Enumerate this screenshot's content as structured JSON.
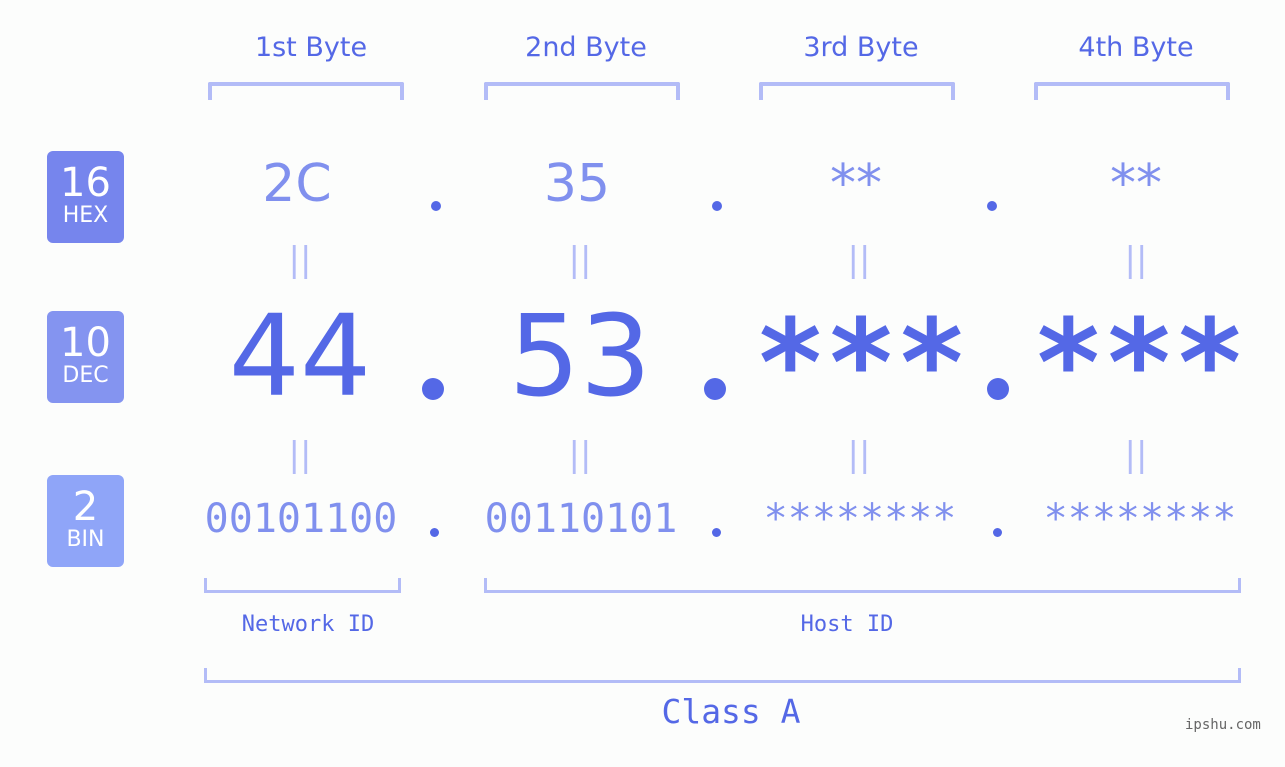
{
  "bytes": [
    {
      "label": "1st Byte",
      "hex": "2C",
      "dec": "44",
      "bin": "00101100"
    },
    {
      "label": "2nd Byte",
      "hex": "35",
      "dec": "53",
      "bin": "00110101"
    },
    {
      "label": "3rd Byte",
      "hex": "**",
      "dec": "***",
      "bin": "********"
    },
    {
      "label": "4th Byte",
      "hex": "**",
      "dec": "***",
      "bin": "********"
    }
  ],
  "rows": {
    "hex": {
      "num": "16",
      "label": "HEX",
      "color": "#7685ed"
    },
    "dec": {
      "num": "10",
      "label": "DEC",
      "color": "#8494f0"
    },
    "bin": {
      "num": "2",
      "label": "BIN",
      "color": "#8fa5f8"
    }
  },
  "equals_symbol": "||",
  "network_id_label": "Network ID",
  "host_id_label": "Host ID",
  "class_label": "Class A",
  "watermark": "ipshu.com",
  "colors": {
    "accent": "#5468e6",
    "light": "#8090ee",
    "bracket": "#b3bcf7"
  }
}
